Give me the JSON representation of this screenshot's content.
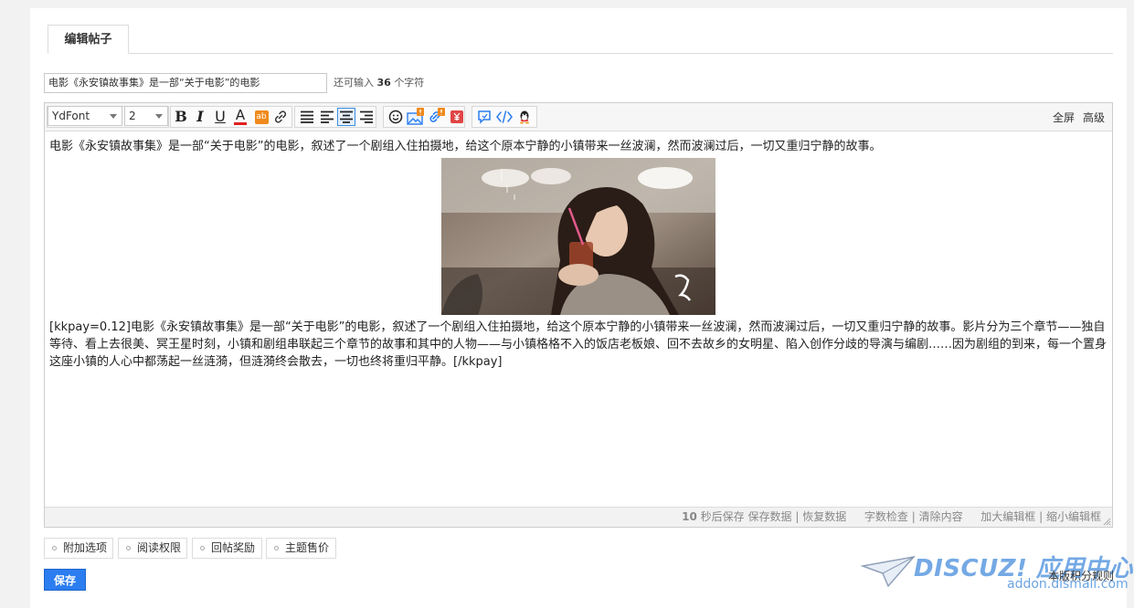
{
  "tab": {
    "label": "编辑帖子"
  },
  "subject": {
    "value": "电影《永安镇故事集》是一部“关于电影”的电影",
    "remaining_prefix": "还可输入",
    "remaining_count": "36",
    "remaining_suffix": "个字符"
  },
  "toolbar": {
    "font_family": "YdFont",
    "font_size": "2",
    "bold_label": "B",
    "italic_label": "I",
    "underline_label": "U",
    "fore_color_label": "A",
    "bg_color_label": "ab",
    "fullscreen_label": "全屏",
    "advanced_label": "高级"
  },
  "content": {
    "intro": "电影《永安镇故事集》是一部“关于电影”的电影，叙述了一个剧组入住拍摄地，给这个原本宁静的小镇带来一丝波澜，然而波澜过后，一切又重归宁静的故事。",
    "body": "[kkpay=0.12]电影《永安镇故事集》是一部“关于电影”的电影，叙述了一个剧组入住拍摄地，给这个原本宁静的小镇带来一丝波澜，然而波澜过后，一切又重归宁静的故事。影片分为三个章节——独自等待、看上去很美、冥王星时刻，小镇和剧组串联起三个章节的故事和其中的人物——与小镇格格不入的饭店老板娘、回不去故乡的女明星、陷入创作分歧的导演与编剧……因为剧组的到来，每一个置身这座小镇的人心中都荡起一丝涟漪，但涟漪终会散去，一切也终将重归平静。[/kkpay]"
  },
  "statusbar": {
    "autosave_seconds": "10",
    "autosave_text": "秒后保存",
    "save_data": "保存数据",
    "sep": "|",
    "restore_data": "恢复数据",
    "word_check": "字数检查",
    "clear_content": "清除内容",
    "enlarge_editor": "加大编辑框",
    "shrink_editor": "缩小编辑框"
  },
  "options": [
    {
      "label": "附加选项"
    },
    {
      "label": "阅读权限"
    },
    {
      "label": "回帖奖励"
    },
    {
      "label": "主题售价"
    }
  ],
  "save_button": "保存",
  "credit_rules": "本版积分规则",
  "watermark": {
    "brand": "DISCUZ! 应用中心",
    "url": "addon.dismall.com"
  },
  "colors": {
    "accent": "#2b7df0",
    "badge": "#f08a1c"
  }
}
